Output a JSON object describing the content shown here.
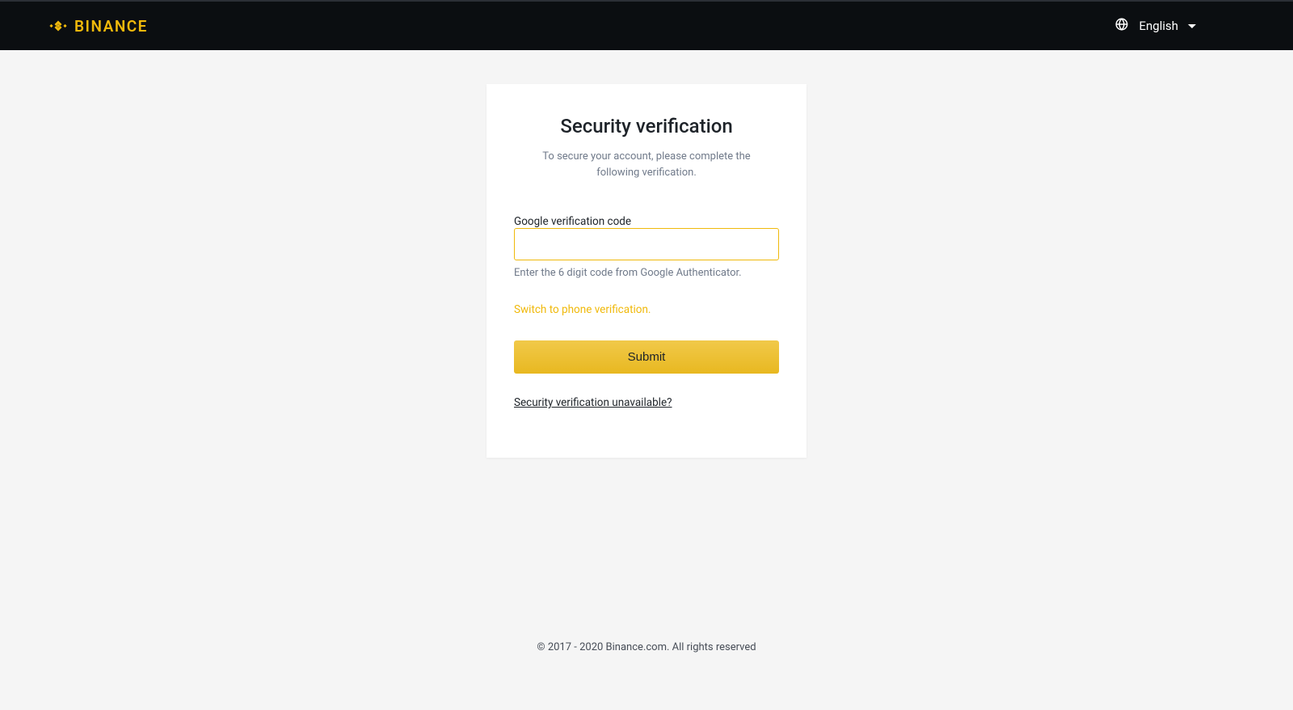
{
  "header": {
    "brand": "BINANCE",
    "language": "English"
  },
  "card": {
    "title": "Security verification",
    "subtitle": "To secure your account, please complete the following verification.",
    "field_label": "Google verification code",
    "input_value": "",
    "hint": "Enter the 6 digit code from Google Authenticator.",
    "switch_link": "Switch to phone verification.",
    "submit_label": "Submit",
    "unavailable_link": "Security verification unavailable?"
  },
  "footer": {
    "copyright": "© 2017 - 2020 Binance.com. All rights reserved"
  }
}
